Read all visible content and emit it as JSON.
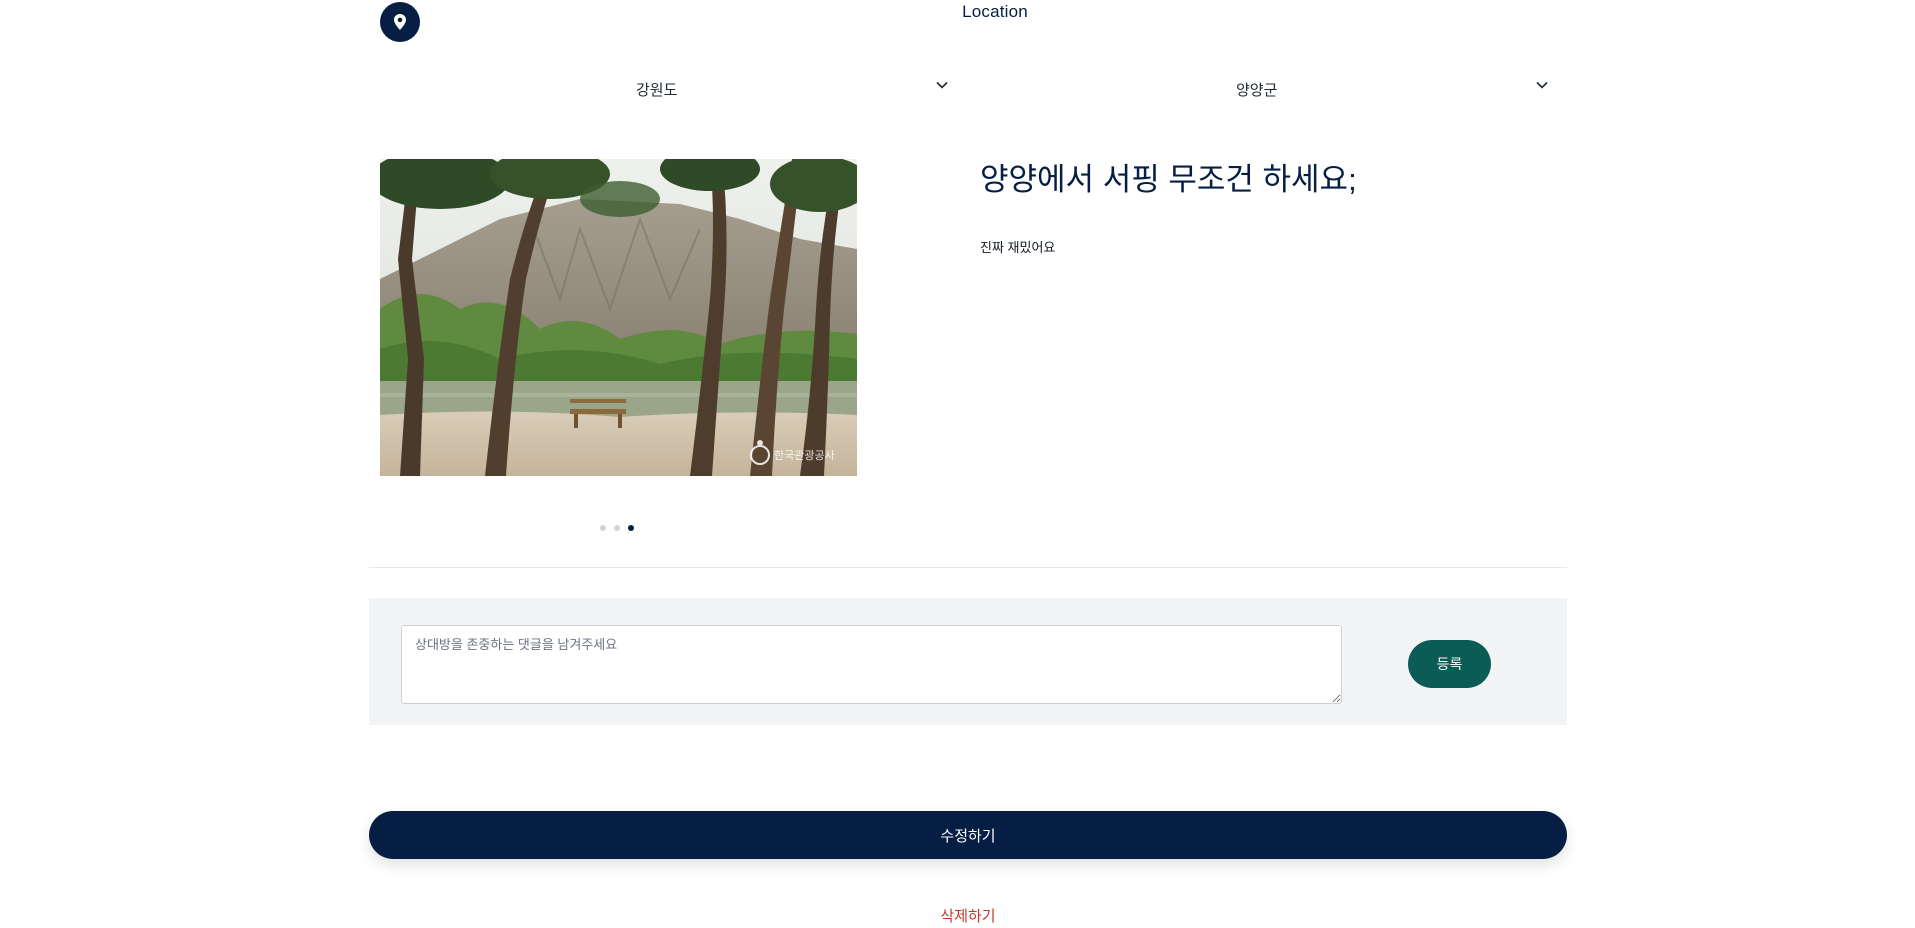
{
  "header": {
    "title": "Location",
    "icon": "map-pin-icon"
  },
  "location": {
    "province": "강원도",
    "district": "양양군"
  },
  "carousel": {
    "slide_count": 3,
    "active_index": 2,
    "image_watermark": "한국관광공사"
  },
  "post": {
    "title": "양양에서 서핑 무조건 하세요;",
    "body": "진짜 재밌어요"
  },
  "comment": {
    "placeholder": "상대방을 존중하는 댓글을 남겨주세요",
    "value": "",
    "submit_label": "등록"
  },
  "actions": {
    "edit_label": "수정하기",
    "delete_label": "삭제하기"
  },
  "colors": {
    "primary": "#061d44",
    "submit": "#0b5c55",
    "danger": "#c0392b",
    "panel": "#f3f4f6"
  }
}
